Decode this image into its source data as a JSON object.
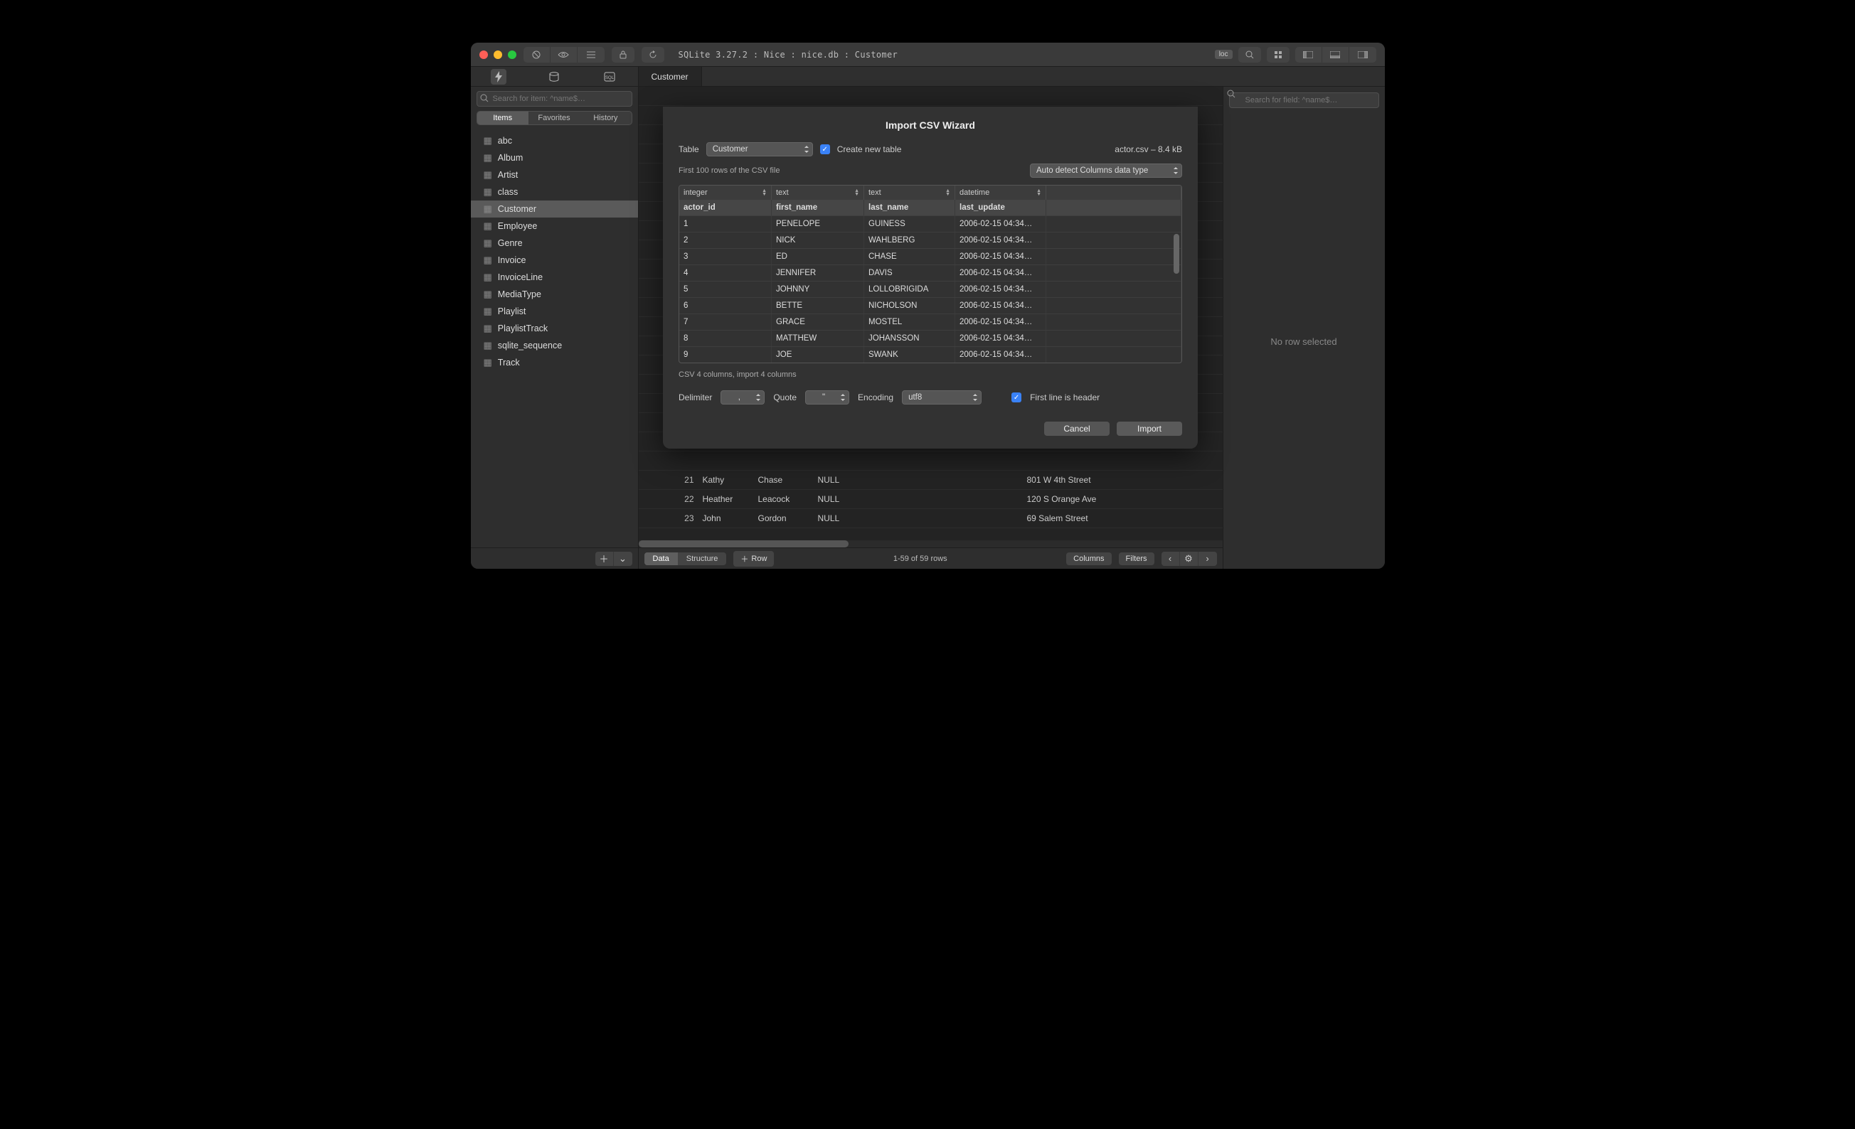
{
  "titlebar": {
    "path": "SQLite 3.27.2 : Nice : nice.db : Customer",
    "loc_badge": "loc"
  },
  "tab": {
    "label": "Customer"
  },
  "sidebar": {
    "search_placeholder": "Search for item: ^name$…",
    "segments": {
      "items": "Items",
      "favorites": "Favorites",
      "history": "History"
    },
    "tables": [
      "abc",
      "Album",
      "Artist",
      "class",
      "Customer",
      "Employee",
      "Genre",
      "Invoice",
      "InvoiceLine",
      "MediaType",
      "Playlist",
      "PlaylistTrack",
      "sqlite_sequence",
      "Track"
    ],
    "selected_index": 4
  },
  "inspector": {
    "search_placeholder": "Search for field: ^name$…",
    "empty_text": "No row selected"
  },
  "footer": {
    "data": "Data",
    "structure": "Structure",
    "row": "Row",
    "status": "1-59 of 59 rows",
    "columns": "Columns",
    "filters": "Filters"
  },
  "bg_rows": [
    {
      "n": "21",
      "a": "Kathy",
      "b": "Chase",
      "c": "NULL",
      "d": "801 W 4th Street"
    },
    {
      "n": "22",
      "a": "Heather",
      "b": "Leacock",
      "c": "NULL",
      "d": "120 S Orange Ave"
    },
    {
      "n": "23",
      "a": "John",
      "b": "Gordon",
      "c": "NULL",
      "d": "69 Salem Street"
    }
  ],
  "dialog": {
    "title": "Import CSV Wizard",
    "table_label": "Table",
    "table_value": "Customer",
    "create_new_table": "Create new table",
    "file_info": "actor.csv  –  8.4 kB",
    "first_rows_hint": "First 100 rows of the CSV file",
    "auto_detect": "Auto detect Columns data type",
    "col_types": [
      "integer",
      "text",
      "text",
      "datetime",
      ""
    ],
    "col_headers": [
      "actor_id",
      "first_name",
      "last_name",
      "last_update",
      ""
    ],
    "rows": [
      {
        "id": "1",
        "f": "PENELOPE",
        "l": "GUINESS",
        "u": "2006-02-15 04:34…"
      },
      {
        "id": "2",
        "f": "NICK",
        "l": "WAHLBERG",
        "u": "2006-02-15 04:34…"
      },
      {
        "id": "3",
        "f": "ED",
        "l": "CHASE",
        "u": "2006-02-15 04:34…"
      },
      {
        "id": "4",
        "f": "JENNIFER",
        "l": "DAVIS",
        "u": "2006-02-15 04:34…"
      },
      {
        "id": "5",
        "f": "JOHNNY",
        "l": "LOLLOBRIGIDA",
        "u": "2006-02-15 04:34…"
      },
      {
        "id": "6",
        "f": "BETTE",
        "l": "NICHOLSON",
        "u": "2006-02-15 04:34…"
      },
      {
        "id": "7",
        "f": "GRACE",
        "l": "MOSTEL",
        "u": "2006-02-15 04:34…"
      },
      {
        "id": "8",
        "f": "MATTHEW",
        "l": "JOHANSSON",
        "u": "2006-02-15 04:34…"
      },
      {
        "id": "9",
        "f": "JOE",
        "l": "SWANK",
        "u": "2006-02-15 04:34…"
      }
    ],
    "summary": "CSV 4 columns, import 4 columns",
    "delimiter_label": "Delimiter",
    "delimiter_value": ",",
    "quote_label": "Quote",
    "quote_value": "\"",
    "encoding_label": "Encoding",
    "encoding_value": "utf8",
    "first_line_header": "First line is header",
    "cancel": "Cancel",
    "import": "Import"
  }
}
